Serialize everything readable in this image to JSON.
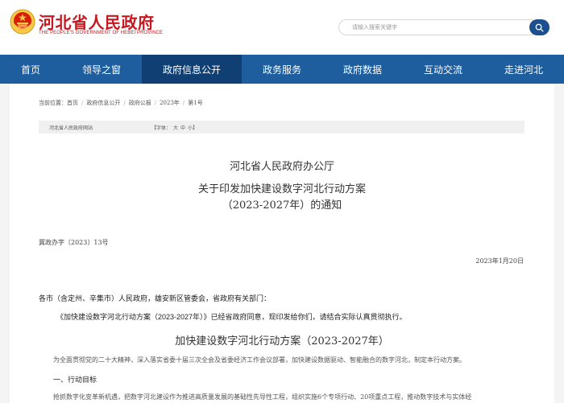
{
  "header": {
    "site_title": "河北省人民政府",
    "site_subtitle": "THE PEOPLE'S GOVERNMENT OF HEBEI PROVINCE",
    "search_placeholder": "请输入搜索关键字",
    "emblem_icon": "national-emblem-icon",
    "search_icon": "search-icon"
  },
  "nav": {
    "items": [
      {
        "label": "首页"
      },
      {
        "label": "领导之窗"
      },
      {
        "label": "政府信息公开"
      },
      {
        "label": "政务服务"
      },
      {
        "label": "政府数据"
      },
      {
        "label": "互动交流"
      },
      {
        "label": "走进河北"
      }
    ],
    "active_index": 2
  },
  "breadcrumb": {
    "prefix": "当前位置：",
    "items": [
      "首页",
      "政府信息公开",
      "政府公报",
      "2023年",
      "第1号"
    ]
  },
  "infobar": {
    "source": "河北省人民政府网站",
    "font_label": "【字体：",
    "font_large": "大",
    "font_medium": "中",
    "font_small": "小",
    "font_end": "】"
  },
  "document": {
    "issuer": "河北省人民政府办公厅",
    "title_line1": "关于印发加快建设数字河北行动方案",
    "title_line2": "（2023-2027年）的通知",
    "number": "冀政办字〔2023〕13号",
    "date": "2023年1月20日",
    "recipients": "各市（含定州、辛集市）人民政府，雄安新区管委会，省政府有关部门：",
    "notice_body": "《加快建设数字河北行动方案（2023-2027年）》已经省政府同意，现印发给你们，请结合实际认真贯彻执行。",
    "plan_title": "加快建设数字河北行动方案（2023-2027年）",
    "para_1": "为全面贯彻党的二十大精神，深入落实省委十届三次全会及省委经济工作会议部署，加快建设数据驱动、智能融合的数字河北，制定本行动方案。",
    "section_1": "一、行动目标",
    "para_2": "抢抓数字化变革新机遇，把数字河北建设作为推进高质量发展的基础性先导性工程，组织实施6个专项行动、20项重点工程，推动数字技术与实体经"
  },
  "colors": {
    "brand_red": "#c8171e",
    "nav_blue": "#1e5d9e",
    "nav_active": "#103f74",
    "search_button": "#1c4f8e"
  }
}
